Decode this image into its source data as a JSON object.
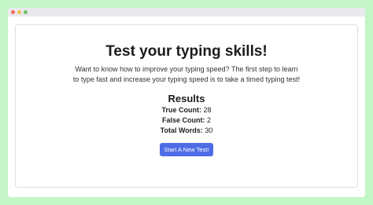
{
  "window": {
    "controls": [
      "close",
      "minimize",
      "maximize"
    ]
  },
  "main": {
    "title": "Test your typing skills!",
    "description": "Want to know how to improve your typing speed? The first step to learn to type fast and increase your typing speed is to take a timed typing test!"
  },
  "results": {
    "heading": "Results",
    "true_count_label": "True Count:",
    "true_count_value": "28",
    "false_count_label": "False Count:",
    "false_count_value": "2",
    "total_words_label": "Total Words:",
    "total_words_value": "30"
  },
  "actions": {
    "new_test_label": "Start A New Test!"
  },
  "colors": {
    "background": "#c4f5c6",
    "button": "#4e6de5"
  }
}
